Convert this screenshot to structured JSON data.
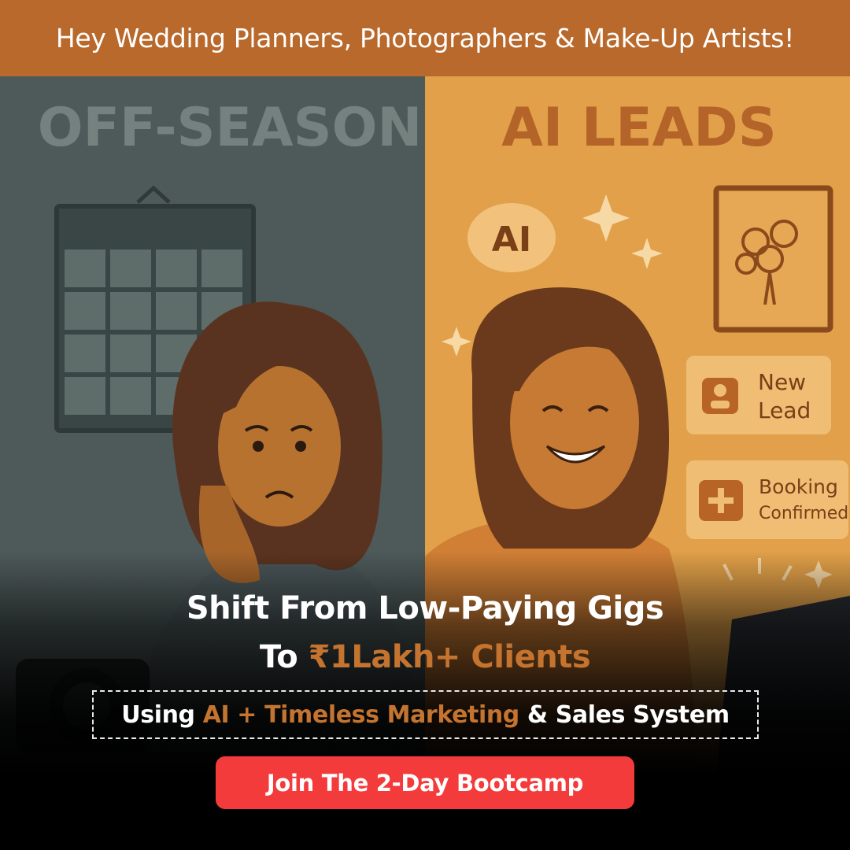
{
  "banner": {
    "text": "Hey Wedding Planners, Photographers & Make-Up Artists!"
  },
  "illustration": {
    "left_title": "OFF-SEASON",
    "right_title": "AI LEADS",
    "ai_badge": "AI",
    "new_lead_card": {
      "line1": "New",
      "line2": "Lead"
    },
    "booking_card": {
      "line1": "Booking",
      "line2": "Confirmed"
    }
  },
  "headline": {
    "line1": "Shift From Low-Paying Gigs",
    "line2_prefix": "To ",
    "line2_accent": "₹1Lakh+ Clients"
  },
  "subline": {
    "prefix": "Using ",
    "accent": "AI + Timeless Marketing",
    "suffix": " & Sales System"
  },
  "cta": {
    "label": "Join The 2-Day Bootcamp"
  },
  "colors": {
    "banner": "#b8692b",
    "accent": "#c4742f",
    "cta": "#f43b3b",
    "left_panel": "#4e5b5a",
    "right_panel": "#e2a04a"
  }
}
